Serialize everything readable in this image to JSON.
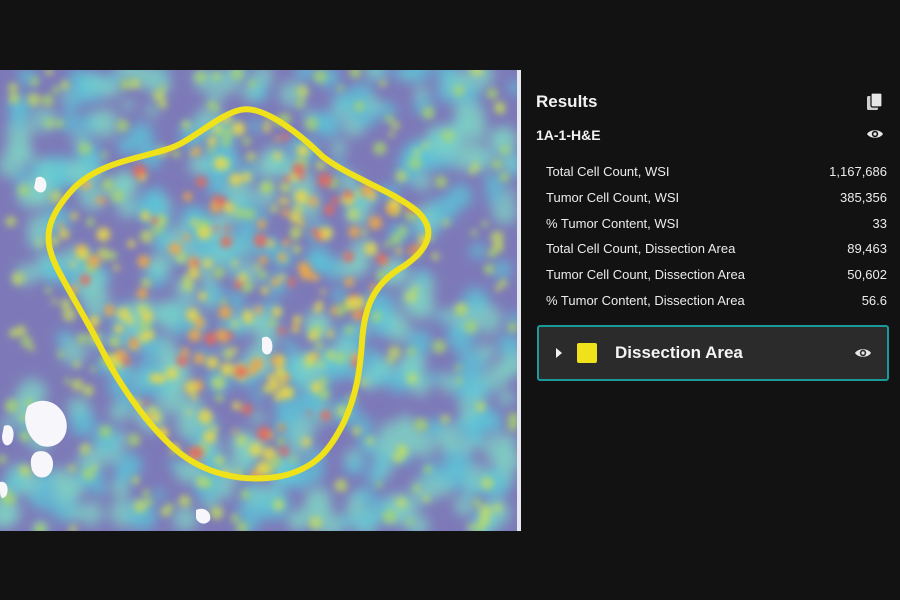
{
  "viewer": {
    "overlay_color": "#f0e21a"
  },
  "results": {
    "title": "Results",
    "copy_icon": "copy-icon",
    "sample": {
      "name": "1A-1-H&E",
      "visibility_icon": "eye-icon"
    },
    "metrics": [
      {
        "label": "Total Cell Count, WSI",
        "value": "1,167,686"
      },
      {
        "label": "Tumor Cell Count, WSI",
        "value": "385,356"
      },
      {
        "label": "% Tumor Content, WSI",
        "value": "33"
      },
      {
        "label": "Total Cell Count, Dissection Area",
        "value": "89,463"
      },
      {
        "label": "Tumor Cell Count, Dissection Area",
        "value": "50,602"
      },
      {
        "label": "% Tumor Content, Dissection Area",
        "value": "56.6"
      }
    ],
    "layer": {
      "name": "Dissection Area",
      "swatch_color": "#f0e21a",
      "border_color": "#1a9a9a",
      "expand_icon": "caret-right-icon",
      "visibility_icon": "eye-icon"
    }
  }
}
